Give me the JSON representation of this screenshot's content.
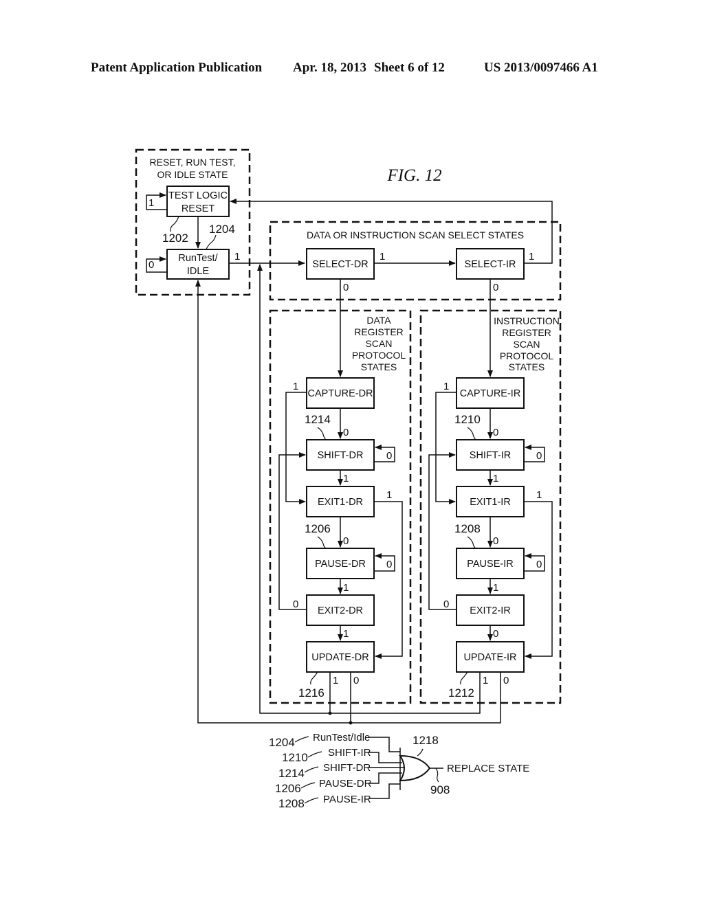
{
  "header": {
    "publication": "Patent Application Publication",
    "date": "Apr. 18, 2013",
    "sheet": "Sheet 6 of 12",
    "number": "US 2013/0097466 A1"
  },
  "figure": {
    "title": "FIG. 12",
    "groups": {
      "reset_idle": [
        "RESET, RUN TEST,",
        "OR IDLE STATE"
      ],
      "scan_select": "DATA OR INSTRUCTION SCAN SELECT STATES",
      "data_register": [
        "DATA",
        "REGISTER",
        "SCAN",
        "PROTOCOL",
        "STATES"
      ],
      "instruction_register": [
        "INSTRUCTION",
        "REGISTER",
        "SCAN",
        "PROTOCOL",
        "STATES"
      ]
    },
    "states": {
      "test_logic_reset": [
        "TEST LOGIC",
        "RESET"
      ],
      "run_test_idle": [
        "RunTest/",
        "IDLE"
      ],
      "select_dr": "SELECT-DR",
      "select_ir": "SELECT-IR",
      "capture_dr": "CAPTURE-DR",
      "shift_dr": "SHIFT-DR",
      "exit1_dr": "EXIT1-DR",
      "pause_dr": "PAUSE-DR",
      "exit2_dr": "EXIT2-DR",
      "update_dr": "UPDATE-DR",
      "capture_ir": "CAPTURE-IR",
      "shift_ir": "SHIFT-IR",
      "exit1_ir": "EXIT1-IR",
      "pause_ir": "PAUSE-IR",
      "exit2_ir": "EXIT2-IR",
      "update_ir": "UPDATE-IR"
    },
    "refs": {
      "r1202": "1202",
      "r1204": "1204",
      "r1214": "1214",
      "r1206": "1206",
      "r1216": "1216",
      "r1210": "1210",
      "r1208": "1208",
      "r1212": "1212",
      "r1218": "1218",
      "r908": "908"
    },
    "transitions": {
      "one": "1",
      "zero": "0"
    },
    "or_gate": {
      "inputs": [
        {
          "ref": "1204",
          "label": "RunTest/Idle"
        },
        {
          "ref": "1210",
          "label": "SHIFT-IR"
        },
        {
          "ref": "1214",
          "label": "SHIFT-DR"
        },
        {
          "ref": "1206",
          "label": "PAUSE-DR"
        },
        {
          "ref": "1208",
          "label": "PAUSE-IR"
        }
      ],
      "output": "REPLACE STATE"
    }
  }
}
